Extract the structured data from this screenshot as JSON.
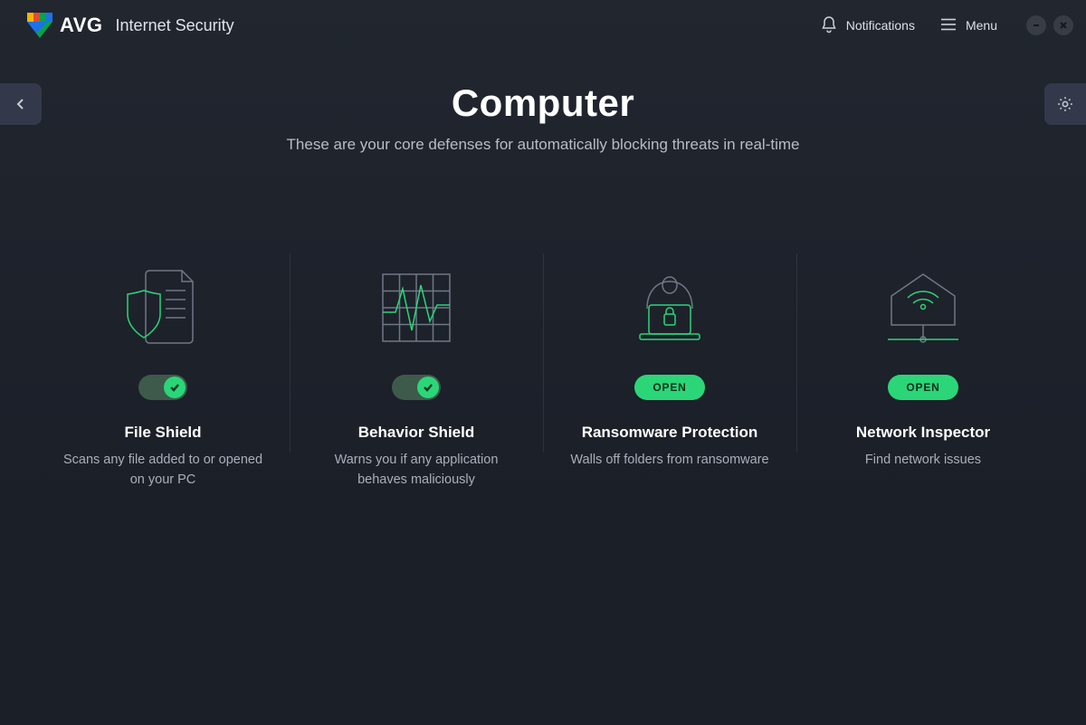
{
  "brand": {
    "name": "AVG",
    "product": "Internet Security"
  },
  "header": {
    "notifications_label": "Notifications",
    "menu_label": "Menu"
  },
  "page": {
    "title": "Computer",
    "subtitle": "These are your core defenses for automatically blocking threats in real-time"
  },
  "open_label": "OPEN",
  "cards": [
    {
      "title": "File Shield",
      "desc": "Scans any file added to or opened on your PC",
      "control": "toggle",
      "state": "on"
    },
    {
      "title": "Behavior Shield",
      "desc": "Warns you if any application behaves maliciously",
      "control": "toggle",
      "state": "on"
    },
    {
      "title": "Ransomware Protection",
      "desc": "Walls off folders from ransomware",
      "control": "open"
    },
    {
      "title": "Network Inspector",
      "desc": "Find network issues",
      "control": "open"
    }
  ]
}
